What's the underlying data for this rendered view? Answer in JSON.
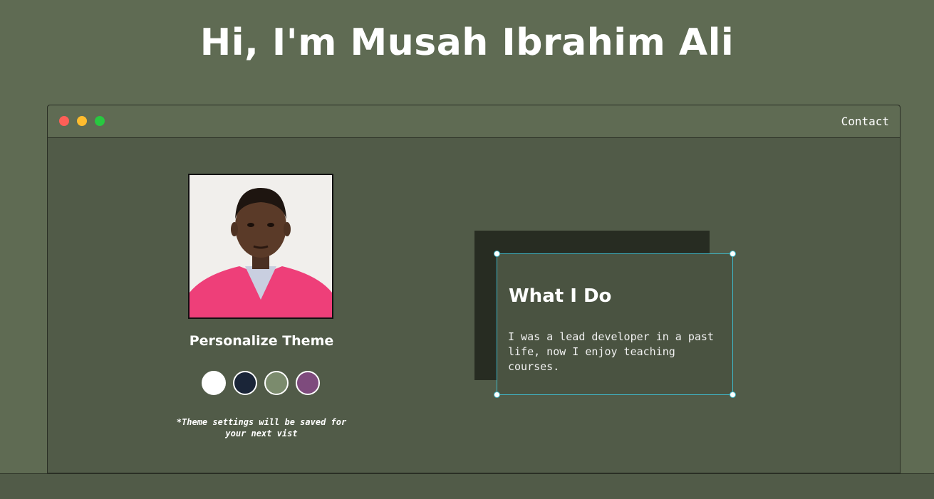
{
  "header": {
    "title": "Hi, I'm Musah Ibrahim Ali"
  },
  "window": {
    "nav": {
      "contact_label": "Contact"
    },
    "traffic_lights": [
      "#ff5f57",
      "#febc2e",
      "#28c840"
    ]
  },
  "profile": {
    "photo_icon": "profile-photo",
    "theme_heading": "Personalize Theme",
    "theme_swatches": [
      {
        "name": "light",
        "color": "#ffffff"
      },
      {
        "name": "blue",
        "color": "#1a2538"
      },
      {
        "name": "green",
        "color": "#7b8b6d"
      },
      {
        "name": "purple",
        "color": "#7e4b7d"
      }
    ],
    "theme_note": "*Theme settings will be saved for your next vist"
  },
  "about": {
    "title": "What I Do",
    "body": "I was a lead developer in a past life, now I enjoy teaching courses."
  },
  "colors": {
    "page_bg": "#5f6b53",
    "window_bg": "#515b48",
    "card_shadow": "#272c22",
    "selection": "#3fb8c9"
  }
}
